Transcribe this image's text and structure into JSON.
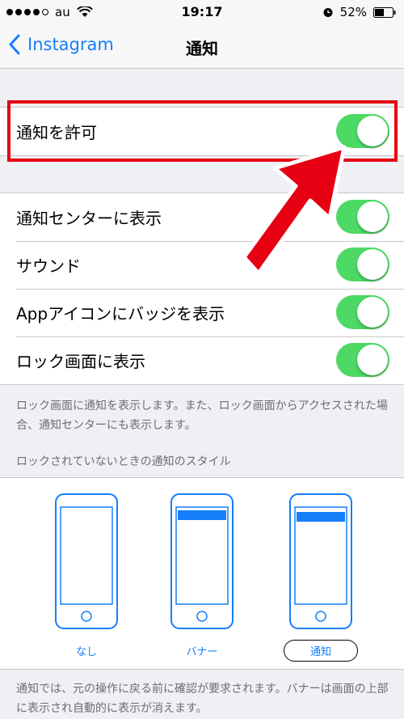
{
  "status_bar": {
    "carrier": "au",
    "time": "19:17",
    "battery": "52%"
  },
  "nav": {
    "back_label": "Instagram",
    "title": "通知"
  },
  "allow_row": {
    "label": "通知を許可",
    "on": true
  },
  "settings_rows": [
    {
      "label": "通知センターに表示",
      "on": true
    },
    {
      "label": "サウンド",
      "on": true
    },
    {
      "label": "Appアイコンにバッジを表示",
      "on": true
    },
    {
      "label": "ロック画面に表示",
      "on": true
    }
  ],
  "lock_screen_note": "ロック画面に通知を表示します。また、ロック画面からアクセスされた場合、通知センターにも表示します。",
  "style_section_header": "ロックされていないときの通知のスタイル",
  "style_options": [
    {
      "label": "なし",
      "selected": false
    },
    {
      "label": "バナー",
      "selected": false
    },
    {
      "label": "通知",
      "selected": true
    }
  ],
  "bottom_note": "通知では、元の操作に戻る前に確認が要求されます。バナーは画面の上部に表示され自動的に表示が消えます。",
  "colors": {
    "accent": "#157efb",
    "toggle_on": "#4cd964",
    "highlight": "#e60012"
  }
}
